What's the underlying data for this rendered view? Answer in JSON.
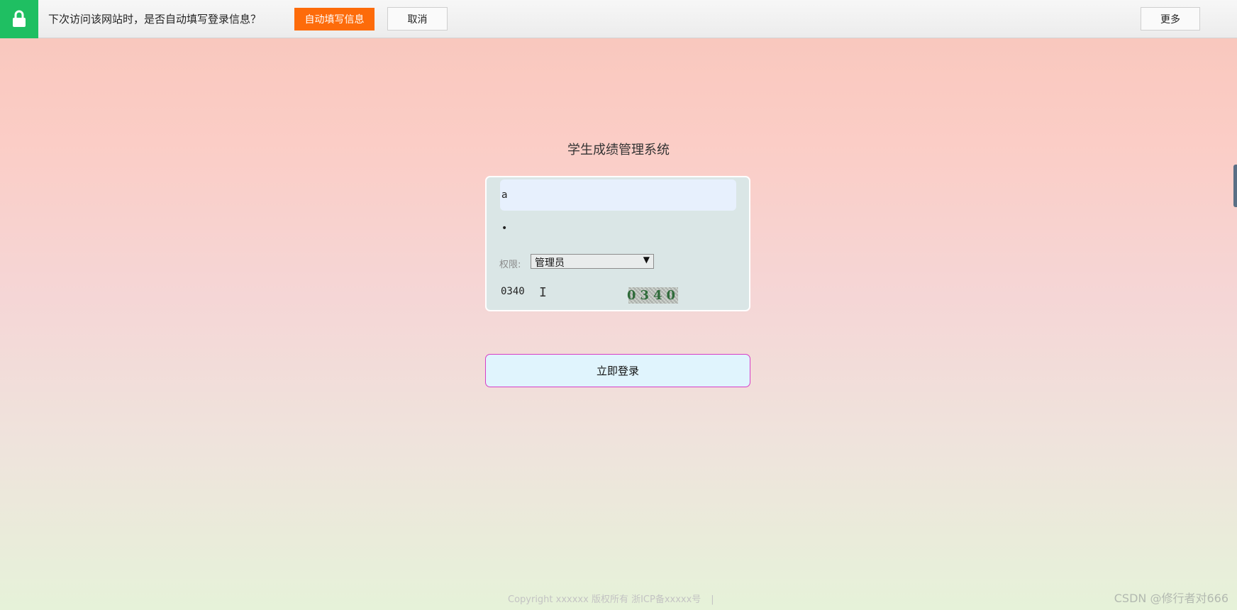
{
  "password_bar": {
    "prompt": "下次访问该网站时，是否自动填写登录信息？",
    "autofill_label": "自动填写信息",
    "cancel_label": "取消",
    "more_label": "更多",
    "icon": "lock-icon"
  },
  "page": {
    "title": "学生成绩管理系统"
  },
  "login_form": {
    "username_value": "a",
    "password_value": "•",
    "role_label": "权限:",
    "role_selected": "管理员",
    "code_value": "0340",
    "captcha_text": "0340",
    "submit_label": "立即登录"
  },
  "footer": {
    "copyright": "Copyright xxxxxx 版权所有 浙ICP备xxxxx号",
    "separator": "|"
  },
  "watermark": "CSDN @修行者对666",
  "colors": {
    "accent_orange": "#fd6b0a",
    "lock_green": "#1fbf62",
    "button_border_pink": "#d63ec6",
    "panel_bg": "#dae6e6"
  }
}
